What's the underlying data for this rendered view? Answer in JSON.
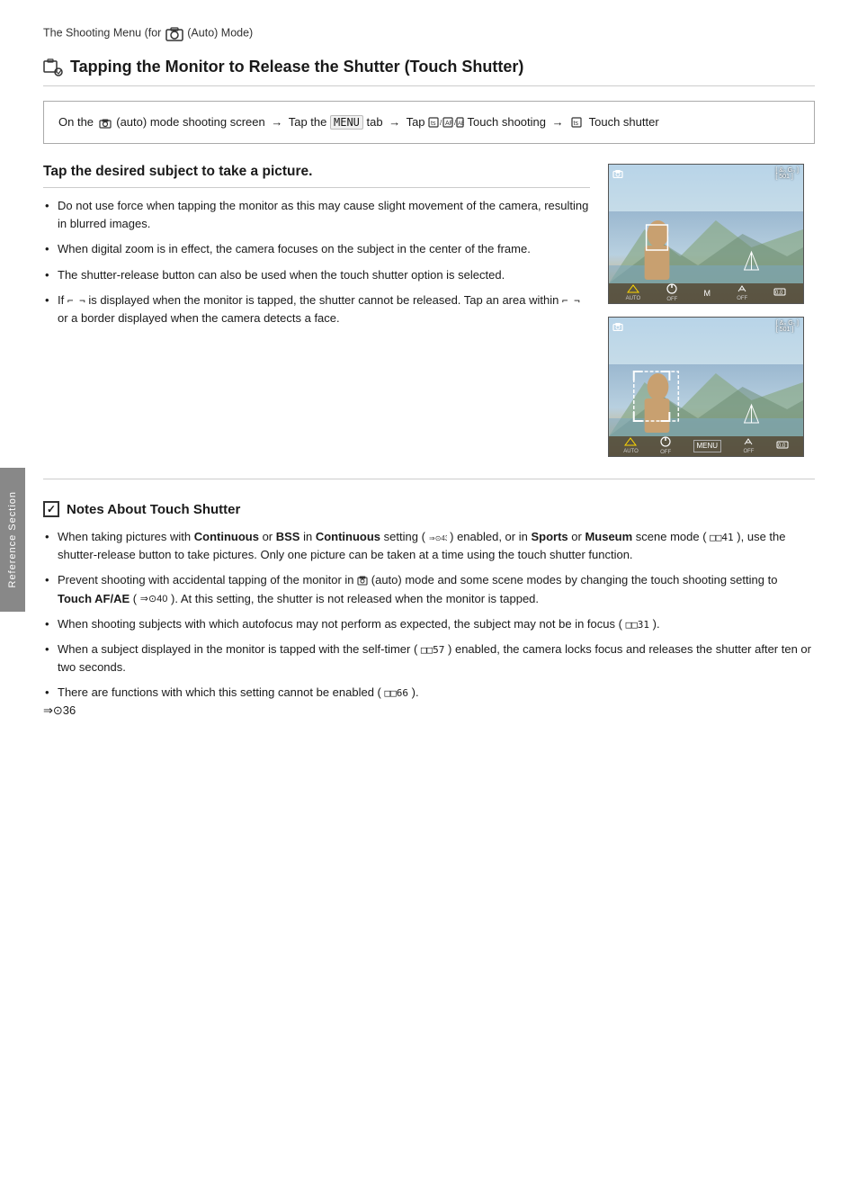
{
  "page": {
    "top_label": "The Shooting Menu (for 📷 (Auto) Mode)",
    "section_title": "Tapping the Monitor to Release the Shutter (Touch Shutter)",
    "nav_box": {
      "line1": "On the 📷 (auto) mode shooting screen → Tap the MENU tab → Tap 📷/📷/📷 Touch shooting → 📷 Touch shutter"
    },
    "subsection_title": "Tap the desired subject to take a picture.",
    "bullets": [
      "Do not use force when tapping the monitor as this may cause slight movement of the camera, resulting in blurred images.",
      "When digital zoom is in effect, the camera focuses on the subject in the center of the frame.",
      "The shutter-release button can also be used when the touch shutter option is selected.",
      "If ┌ ┐ is displayed when the monitor is tapped, the shutter cannot be released. Tap an area within ┌ ┐ or a border displayed when the camera detects a face."
    ],
    "notes_title": "Notes About Touch Shutter",
    "notes_bullets": [
      "When taking pictures with Continuous or BSS in Continuous setting (←0←43) enabled, or in Sports or Museum scene mode (←41), use the shutter-release button to take pictures. Only one picture can be taken at a time using the touch shutter function.",
      "Prevent shooting with accidental tapping of the monitor in 📷 (auto) mode and some scene modes by changing the touch shooting setting to Touch AF/AE (←0←40). At this setting, the shutter is not released when the monitor is tapped.",
      "When shooting subjects with which autofocus may not perform as expected, the subject may not be in focus (←31).",
      "When a subject displayed in the monitor is tapped with the self-timer (←57) enabled, the camera locks focus and releases the shutter after ten or two seconds.",
      "There are functions with which this setting cannot be enabled (←66)."
    ],
    "footer": "←0←36",
    "sidebar_label": "Reference Section",
    "camera_screen1": {
      "top_right": "[ &₀ G₀ ]",
      "top_right2": "[ 501 ]",
      "btn1": "AUTO",
      "btn2": "OFF",
      "btn3": "M",
      "btn4": "OFF",
      "btn5": "0.0"
    },
    "camera_screen2": {
      "top_right": "[ &₀ G₁ ]",
      "top_right2": "[ 501 ]",
      "btn1": "AUTO",
      "btn2": "OFF",
      "btn3": "MENU",
      "btn4": "OFF",
      "btn5": "0.0"
    }
  }
}
